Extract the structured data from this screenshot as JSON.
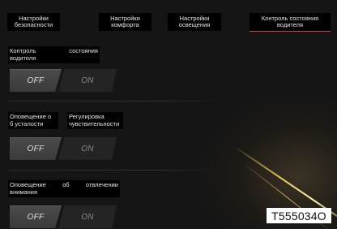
{
  "tabs": [
    {
      "label": "Настройки\nбезопасности",
      "active": false
    },
    {
      "label": "Настройки\nкомфорта",
      "active": false
    },
    {
      "label": "Настройки\nосвещения",
      "active": false
    },
    {
      "label": "Контроль состояния\nводителя",
      "active": true
    }
  ],
  "settings": [
    {
      "label_left": "Контроль",
      "label_right": "состояния",
      "label_line2": "водителя",
      "off": "OFF",
      "on": "ON",
      "selected": "OFF"
    },
    {
      "label_a_line1": "Оповещение о",
      "label_a_line2": "б усталости",
      "label_b_line1": "Регулировка",
      "label_b_line2": "чувствительности",
      "off": "OFF",
      "on": "ON",
      "selected": "OFF"
    },
    {
      "label_left": "Оповещение",
      "label_mid": "об",
      "label_right": "отвлечении",
      "label_line2": "внимания",
      "off": "OFF",
      "on": "ON",
      "selected": "OFF"
    }
  ],
  "image_code": "T555034O",
  "colors": {
    "background": "#151515",
    "active_tab_underline": "#d0424a",
    "label_bg": "#000000"
  }
}
